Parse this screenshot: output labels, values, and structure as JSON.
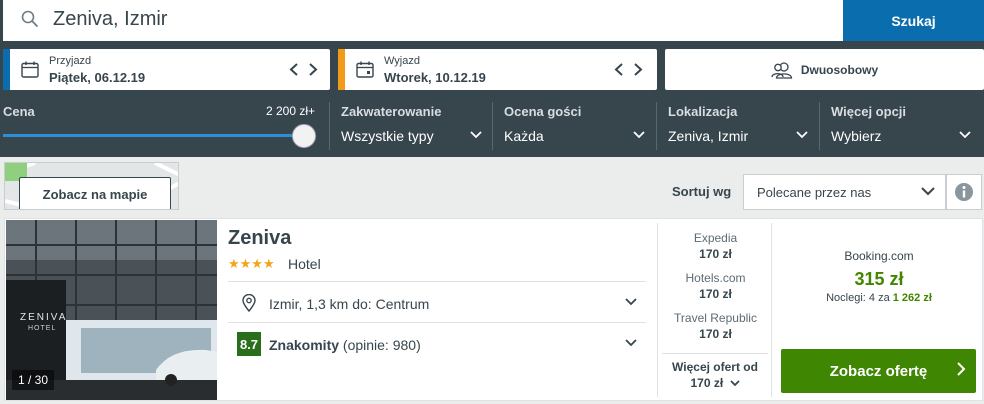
{
  "search": {
    "query": "Zeniva, Izmir",
    "button_label": "Szukaj"
  },
  "dates": {
    "checkin": {
      "label": "Przyjazd",
      "value": "Piątek, 06.12.19",
      "accent": "#0a6dad"
    },
    "checkout": {
      "label": "Wyjazd",
      "value": "Wtorek, 10.12.19",
      "accent": "#f29b18"
    }
  },
  "guests": {
    "label": "Dwuosobowy"
  },
  "filters": {
    "price": {
      "label": "Cena",
      "value": "2 200 zł+",
      "level": 1.0
    },
    "accommodation": {
      "label": "Zakwaterowanie",
      "value": "Wszystkie typy"
    },
    "rating": {
      "label": "Ocena gości",
      "value": "Każda"
    },
    "location": {
      "label": "Lokalizacja",
      "value": "Zeniva, Izmir"
    },
    "more": {
      "label": "Więcej opcji",
      "value": "Wybierz"
    }
  },
  "map": {
    "button_label": "Zobacz na mapie"
  },
  "sort": {
    "label": "Sortuj wg",
    "selected": "Polecane przez nas"
  },
  "hotel": {
    "name": "Zeniva",
    "stars": 4,
    "stars_text": "★★★★",
    "type": "Hotel",
    "photo_counter": "1 / 30",
    "photo_sign": "ZENIVA",
    "photo_sign_sub": "HOTEL",
    "location": "Izmir, 1,3 km do: Centrum",
    "rating_score": "8.7",
    "rating_label": "Znakomity",
    "rating_reviews": "(opinie: 980)",
    "offers": [
      {
        "provider": "Expedia",
        "price": "170 zł"
      },
      {
        "provider": "Hotels.com",
        "price": "170 zł"
      },
      {
        "provider": "Travel Republic",
        "price": "170 zł"
      }
    ],
    "more_offers_label": "Więcej ofert od",
    "more_offers_price": "170 zł",
    "best_offer": {
      "provider": "Booking.com",
      "price": "315 zł",
      "nights_text": "Noclegi: 4 za",
      "total": "1 262 zł"
    },
    "cta_label": "Zobacz ofertę"
  },
  "colors": {
    "dark_bg": "#37454d",
    "search_blue": "#0a6dad",
    "cta_green": "#3f8602",
    "price_green": "#428500",
    "rating_green": "#2a6e1c",
    "star_gold": "#f2a51a"
  }
}
